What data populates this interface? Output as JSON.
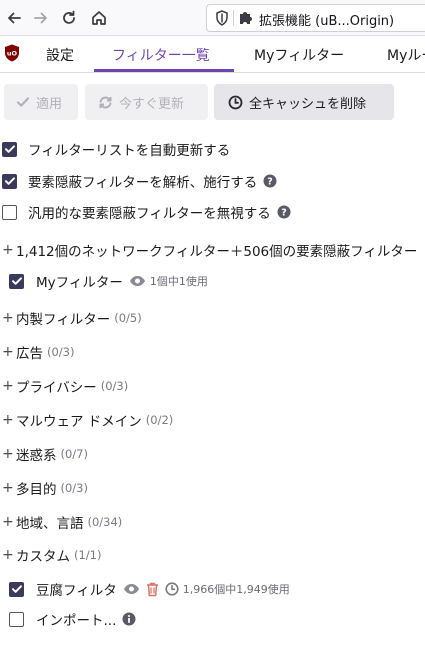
{
  "browser": {
    "url_title": "拡張機能 (uB...Origin)"
  },
  "tabs": [
    {
      "label": "設定"
    },
    {
      "label": "フィルター一覧"
    },
    {
      "label": "Myフィルター"
    },
    {
      "label": "Myルー"
    }
  ],
  "actions": {
    "apply": "適用",
    "update_now": "今すぐ更新",
    "purge_all": "全キャッシュを削除"
  },
  "options": [
    {
      "label": "フィルターリストを自動更新する",
      "checked": true
    },
    {
      "label": "要素隠蔽フィルターを解析、施行する",
      "checked": true
    },
    {
      "label": "汎用的な要素隠蔽フィルターを無視する",
      "checked": false
    }
  ],
  "summary": "1,412個のネットワークフィルター＋506個の要素隠蔽フィルター",
  "my_filters": {
    "label": "Myフィルター",
    "usage": "1個中1使用"
  },
  "groups": [
    {
      "label": "内製フィルター",
      "count": "(0/5)"
    },
    {
      "label": "広告",
      "count": "(0/3)"
    },
    {
      "label": "プライバシー",
      "count": "(0/3)"
    },
    {
      "label": "マルウェア ドメイン",
      "count": "(0/2)"
    },
    {
      "label": "迷惑系",
      "count": "(0/7)"
    },
    {
      "label": "多目的",
      "count": "(0/3)"
    },
    {
      "label": "地域、言語",
      "count": "(0/34)"
    },
    {
      "label": "カスタム",
      "count": "(1/1)"
    }
  ],
  "custom_list": {
    "label": "豆腐フィルタ",
    "usage": "1,966個中1,949使用"
  },
  "import": {
    "label": "インポート..."
  }
}
